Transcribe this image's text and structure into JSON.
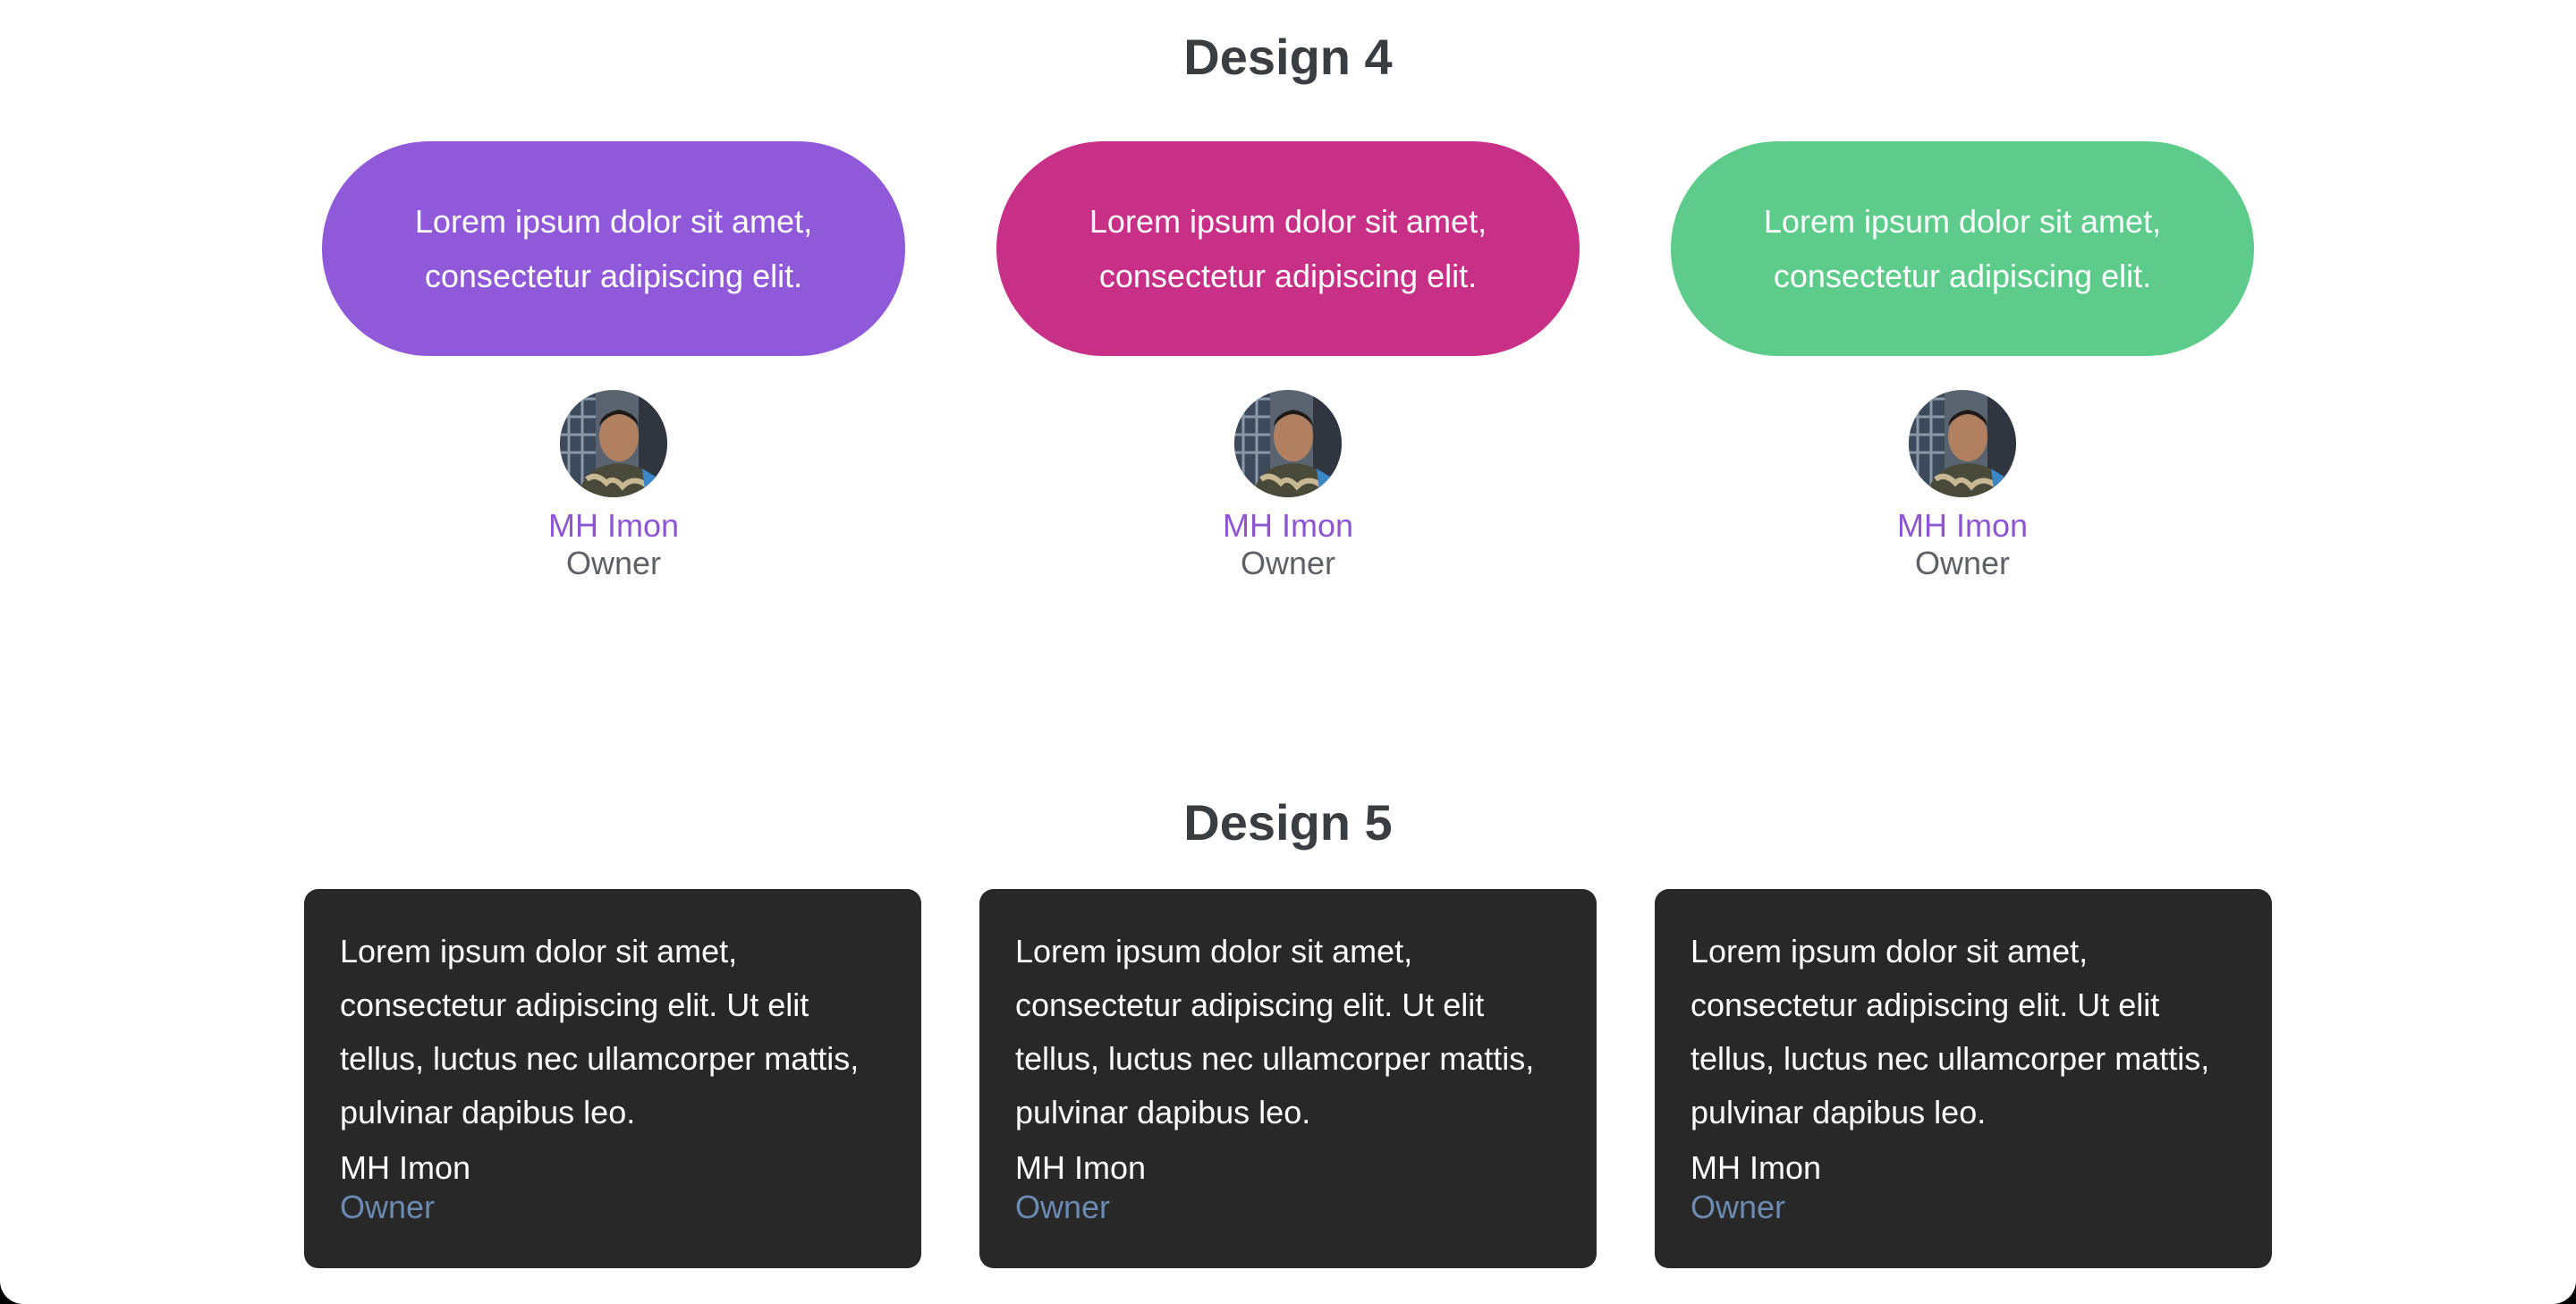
{
  "design4": {
    "title": "Design 4",
    "cards": [
      {
        "text_line1": "Lorem ipsum dolor sit amet,",
        "text_line2": "consectetur adipiscing elit.",
        "name": "MH Imon",
        "role": "Owner",
        "color": "#9059d9"
      },
      {
        "text_line1": "Lorem ipsum dolor sit amet,",
        "text_line2": "consectetur adipiscing elit.",
        "name": "MH Imon",
        "role": "Owner",
        "color": "#c83088"
      },
      {
        "text_line1": "Lorem ipsum dolor sit amet,",
        "text_line2": "consectetur adipiscing elit.",
        "name": "MH Imon",
        "role": "Owner",
        "color": "#5dcc8b"
      }
    ]
  },
  "design5": {
    "title": "Design 5",
    "cards": [
      {
        "text": "Lorem ipsum dolor sit amet, consectetur adipiscing elit. Ut elit tellus, luctus nec ullamcorper mattis, pulvinar dapibus leo.",
        "name": "MH Imon",
        "role": "Owner"
      },
      {
        "text": "Lorem ipsum dolor sit amet, consectetur adipiscing elit. Ut elit tellus, luctus nec ullamcorper mattis, pulvinar dapibus leo.",
        "name": "MH Imon",
        "role": "Owner"
      },
      {
        "text": "Lorem ipsum dolor sit amet, consectetur adipiscing elit. Ut elit tellus, luctus nec ullamcorper mattis, pulvinar dapibus leo.",
        "name": "MH Imon",
        "role": "Owner"
      }
    ]
  },
  "colors": {
    "title": "#3a3d42",
    "name_accent": "#8e55d3",
    "role_muted": "#5e6066",
    "dark_card": "#282828",
    "dark_role": "#6b8bb3"
  }
}
